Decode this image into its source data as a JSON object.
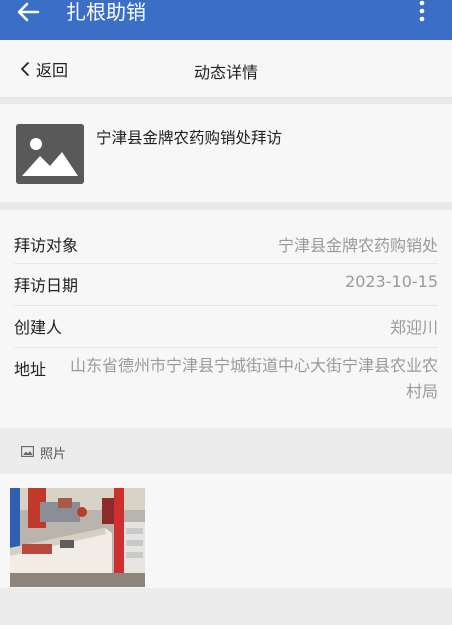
{
  "appbar": {
    "title": "扎根助销",
    "back_icon": "arrow-left-icon",
    "menu_icon": "more-vertical-icon",
    "color": "#3b6fc6"
  },
  "subheader": {
    "back_label": "返回",
    "title": "动态详情"
  },
  "summary": {
    "headline": "宁津县金牌农药购销处拜访",
    "thumb_icon": "image-placeholder-icon"
  },
  "details": {
    "target": {
      "label": "拜访对象",
      "value": "宁津县金牌农药购销处"
    },
    "date": {
      "label": "拜访日期",
      "value": "2023-10-15"
    },
    "creator": {
      "label": "创建人",
      "value": "郑迎川"
    },
    "address": {
      "label": "地址",
      "value": "山东省德州市宁津县宁城街道中心大街宁津县农业农村局"
    }
  },
  "photos_section": {
    "label": "照片",
    "icon": "image-icon"
  }
}
